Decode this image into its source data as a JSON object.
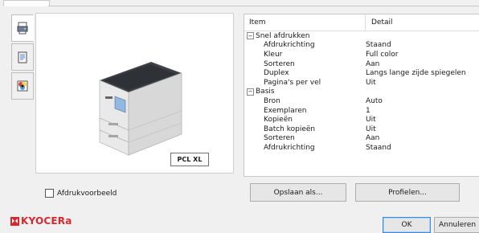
{
  "preview": {
    "badge": "PCL XL"
  },
  "properties": {
    "col_item": "Item",
    "col_detail": "Detail",
    "rows": [
      {
        "type": "group",
        "label": "Snel afdrukken",
        "value": ""
      },
      {
        "type": "item",
        "label": "Afdrukrichting",
        "value": "Staand"
      },
      {
        "type": "item",
        "label": "Kleur",
        "value": "Full color"
      },
      {
        "type": "item",
        "label": "Sorteren",
        "value": "Aan"
      },
      {
        "type": "item",
        "label": "Duplex",
        "value": "Langs lange zijde spiegelen"
      },
      {
        "type": "item",
        "label": "Pagina's per vel",
        "value": "Uit"
      },
      {
        "type": "group",
        "label": "Basis",
        "value": ""
      },
      {
        "type": "item",
        "label": "Bron",
        "value": "Auto"
      },
      {
        "type": "item",
        "label": "Exemplaren",
        "value": "1"
      },
      {
        "type": "item",
        "label": "Kopieën",
        "value": "Uit"
      },
      {
        "type": "item",
        "label": "Batch kopieën",
        "value": "Uit"
      },
      {
        "type": "item",
        "label": "Sorteren",
        "value": "Aan"
      },
      {
        "type": "item",
        "label": "Afdrukrichting",
        "value": "Staand"
      }
    ]
  },
  "print_preview_checkbox": {
    "label": "Afdrukvoorbeeld",
    "checked": false
  },
  "buttons": {
    "save_as": "Opslaan als...",
    "profiles": "Profielen...",
    "ok": "OK",
    "cancel": "Annuleren"
  },
  "brand": {
    "name": "KYOCERa",
    "color": "#d8282f"
  },
  "side_tab_icons": [
    "printer-icon",
    "document-icon",
    "color-icon"
  ]
}
